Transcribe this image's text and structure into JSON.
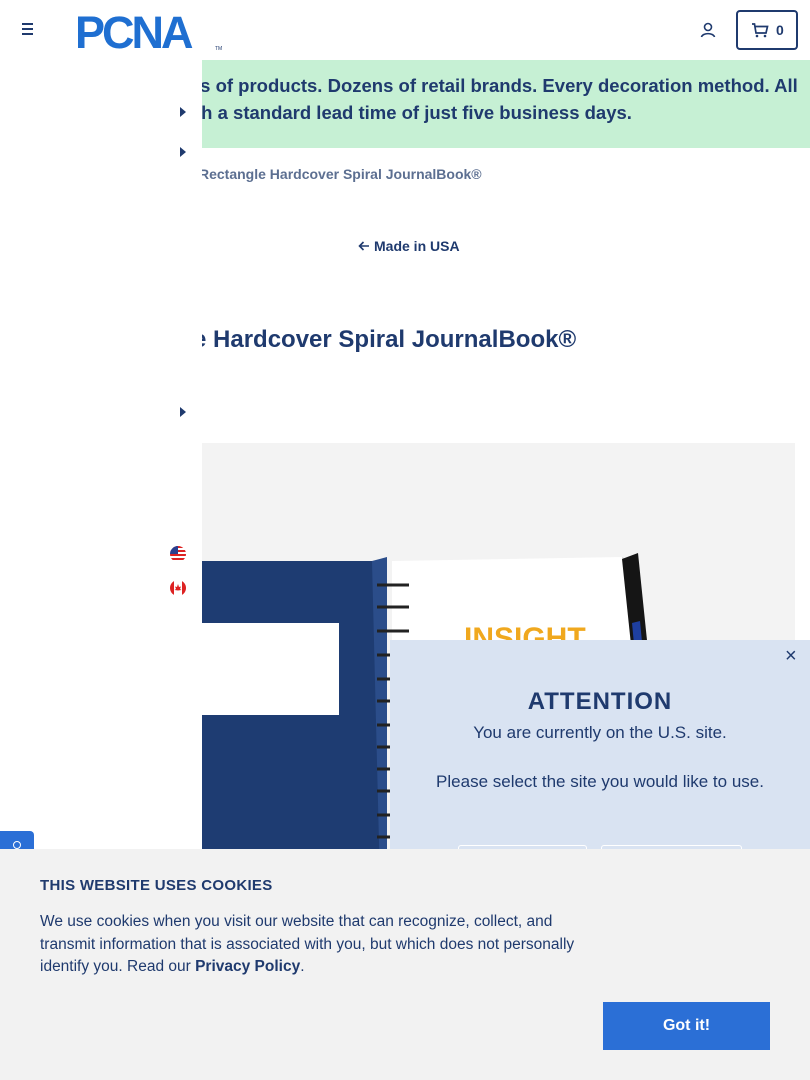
{
  "header": {
    "logo_text": "PCNA",
    "logo_tm": "TM",
    "cart_count": "0"
  },
  "banner": {
    "line1": "ls of products. Dozens of retail brands. Every decoration method. All",
    "line2": "th a standard lead time of just five business days."
  },
  "breadcrumb": {
    "current": "Rectangle Hardcover Spiral JournalBook®"
  },
  "back_link": {
    "label": "Made in USA"
  },
  "product": {
    "title": "e Hardcover Spiral JournalBook®",
    "image_brand_text": "INSIGHT"
  },
  "modal": {
    "close": "×",
    "title": "ATTENTION",
    "line1": "You are currently on the U.S. site.",
    "line2": "Please select the site you would like to use."
  },
  "cookie": {
    "title": "THIS WEBSITE USES COOKIES",
    "text": "We use cookies when you visit our website that can recognize, collect, and transmit information that is associated with you, but which does not personally identify you. Read our ",
    "link": "Privacy Policy",
    "after": ".",
    "button": "Got it!"
  },
  "colors": {
    "brand_navy": "#1f3a6e",
    "banner_green": "#c6f0d4",
    "accent_blue": "#2b6fd6",
    "modal_bg": "#d9e3f2",
    "cookie_bg": "#f2f2f2"
  },
  "icons": [
    "hamburger-icon",
    "account-icon",
    "cart-icon",
    "caret-right-icon",
    "arrow-left-icon",
    "us-flag-icon",
    "canada-flag-icon",
    "close-icon",
    "help-icon"
  ]
}
